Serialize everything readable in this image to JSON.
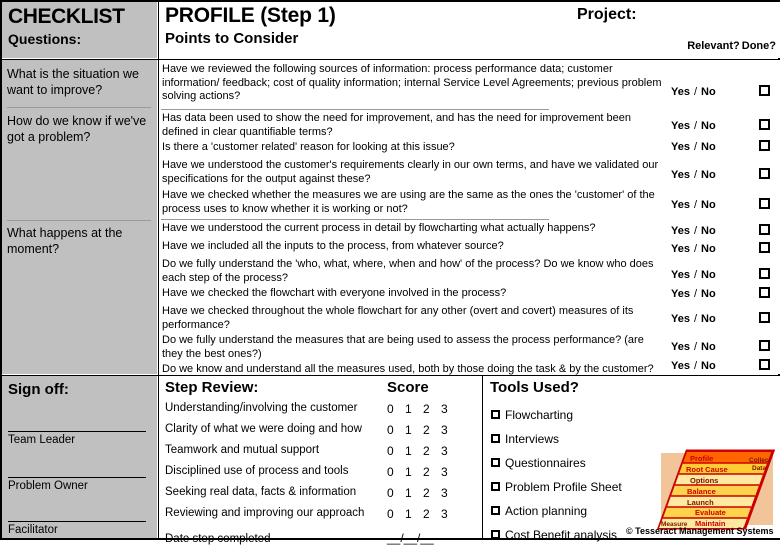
{
  "header": {
    "checklist_title": "CHECKLIST",
    "checklist_subtitle": "Questions:",
    "profile_title": "PROFILE  (Step 1)",
    "profile_subtitle": "Points to Consider",
    "project_label": "Project:",
    "relevant_label": "Relevant?",
    "done_label": "Done?"
  },
  "questions": [
    {
      "text": "What is the situation we want to improve?"
    },
    {
      "text": "How do we know if we've got a problem?"
    },
    {
      "text": "What happens at the moment?"
    }
  ],
  "points": [
    {
      "text": "Have we reviewed the following sources of information: process performance data; customer information/ feedback; cost of quality information; internal Service Level Agreements; previous problem solving actions?"
    },
    {
      "text": "Has data been used to show the need for improvement, and has the need for improvement been defined in clear quantifiable terms?"
    },
    {
      "text": "Is there a 'customer related' reason for looking at this issue?"
    },
    {
      "text": "Have we understood the customer's requirements clearly in our own terms, and have we validated our specifications for the output against these?"
    },
    {
      "text": "Have we checked whether the measures we are using are the same as the ones the 'customer' of the process uses to know whether it is working or not?"
    },
    {
      "text": "Have we understood the current process in detail by flowcharting what actually happens?"
    },
    {
      "text": "Have we included all the inputs to the process, from whatever source?"
    },
    {
      "text": "Do we fully understand the 'who, what, where, when and how' of the process? Do we know who does each step of the process?"
    },
    {
      "text": "Have we checked the flowchart with everyone involved in the process?"
    },
    {
      "text": "Have we checked throughout the whole flowchart for any other (overt and covert) measures of its performance?"
    },
    {
      "text": "Do we fully understand the measures that are being used to assess the process performance? (are they the best ones?)"
    },
    {
      "text": "Do we know and understand all the measures used, both by those doing the task & by the customer?"
    }
  ],
  "relevance": {
    "yes_label": "Yes",
    "separator": "/",
    "no_label": "No"
  },
  "signoff": {
    "title": "Sign off:",
    "roles": [
      "Team Leader",
      "Problem Owner",
      "Facilitator"
    ]
  },
  "step_review": {
    "title": "Step Review:",
    "score_title": "Score",
    "score_options": [
      "0",
      "1",
      "2",
      "3"
    ],
    "criteria": [
      "Understanding/involving the customer",
      "Clarity of what we were doing and how",
      "Teamwork and mutual support",
      "Disciplined use of process and tools",
      "Seeking real data, facts & information",
      "Reviewing and improving our approach"
    ],
    "date_label": "Date step completed",
    "date_value": "__/__/__"
  },
  "tools": {
    "title": "Tools Used?",
    "items": [
      "Flowcharting",
      "Interviews",
      "Questionnaires",
      "Problem Profile Sheet",
      "Action planning",
      "Cost Benefit analysis"
    ]
  },
  "logo": {
    "steps": [
      "Profile",
      "Root Cause",
      "Options",
      "Balance",
      "Launch",
      "Evaluate",
      "Maintain"
    ],
    "side_top": "Collect Data",
    "side_bottom": "Measure",
    "copyright": "© Tesseract Management Systems",
    "colors": {
      "highlight": "#ff6600",
      "band": "#ffd24d",
      "band_alt": "#ffe38a",
      "outline": "#cc0000",
      "backdrop": "#f2c49a"
    }
  }
}
